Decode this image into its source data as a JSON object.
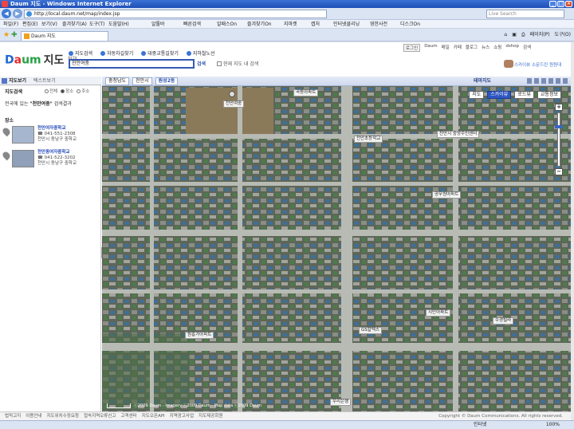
{
  "window": {
    "title": "Daum 지도 - Windows Internet Explorer"
  },
  "browser": {
    "url": "http://local.daum.net/map/index.jsp",
    "search_placeholder": "Live Search",
    "menu": [
      "파일(F)",
      "편집(E)",
      "보기(V)",
      "즐겨찾기(A)",
      "도구(T)",
      "도움말(H)"
    ],
    "toolbar_links": [
      "알툴바",
      "빠른검색",
      "알패스On",
      "즐겨찾기On",
      "지마켓",
      "캡처",
      "인터넷클리닝",
      "영한사전",
      "디스크On"
    ],
    "tab_title": "Daum 지도",
    "tab_tools": [
      "페이지(P)",
      "도구(O)"
    ]
  },
  "site": {
    "logo": {
      "d1": "D",
      "d2": "a",
      "d3": "um",
      "service": "지도",
      "beta": "BETA"
    },
    "tools": [
      "지도검색",
      "자동차길찾기",
      "대중교통길찾기",
      "지하철노선"
    ],
    "search_value": "천안여중",
    "search_button": "검색",
    "current_map_search": "현재 지도 내 검색",
    "top_links": [
      "로그인",
      "Daum",
      "메일",
      "카페",
      "블로그",
      "뉴스",
      "쇼핑",
      "dshop",
      "검색"
    ],
    "promo": "스카이뷰 소문드린 원원대"
  },
  "left_panel": {
    "tab_map": "지도보기",
    "tab_text": "텍스트보기",
    "search_heading": "지도검색",
    "radios": [
      "전체",
      "장소",
      "주소"
    ],
    "selected_radio": "장소",
    "result_prefix": "전국에 있는",
    "result_query": "\"천안여중\"",
    "result_suffix": "검색결과",
    "place_heading": "장소",
    "results": [
      {
        "name": "천안여자중학교",
        "phone": "☎ 041-551-2308",
        "addr": "천안시 동남구 중학교"
      },
      {
        "name": "천안동여자중학교",
        "phone": "☎ 041-522-3202",
        "addr": "천안시 동남구 중학교"
      }
    ]
  },
  "map": {
    "breadcrumbs": [
      "충청남도",
      "천안시",
      "원성2동"
    ],
    "current_crumb_index": 2,
    "mode_title": "테마지도",
    "view_tabs": [
      "지도",
      "스카이뷰",
      "로드뷰",
      "교통정보"
    ],
    "active_tab": "스카이뷰",
    "zoom_level": 0.25,
    "labels": [
      {
        "text": "국동아파트"
      },
      {
        "text": "천안여중"
      },
      {
        "text": "천안초등학교"
      },
      {
        "text": "천안시 중앙주민센터"
      },
      {
        "text": "공무원아파트"
      },
      {
        "text": "시민아파트"
      },
      {
        "text": "GS칼텍스"
      },
      {
        "text": "수경빌라"
      },
      {
        "text": "원흥가아파트"
      },
      {
        "text": "우리은행"
      }
    ],
    "attribution": "ⓒ2009 Daum - Imagery ⓒ2009 Daum - Map data ⓒ2009 Daum",
    "zoom_plus": "+",
    "zoom_minus": "−"
  },
  "footer": {
    "links": [
      "법적고지",
      "이용안내",
      "지도위치수정요청",
      "접속지역오류신고",
      "고객센터",
      "지도오픈API",
      "지역광고사업",
      "지도제공회원"
    ],
    "copyright": "Copyright © Daum Communications. All rights reserved."
  },
  "status": {
    "zone": "인터넷",
    "zoom": "100%"
  }
}
